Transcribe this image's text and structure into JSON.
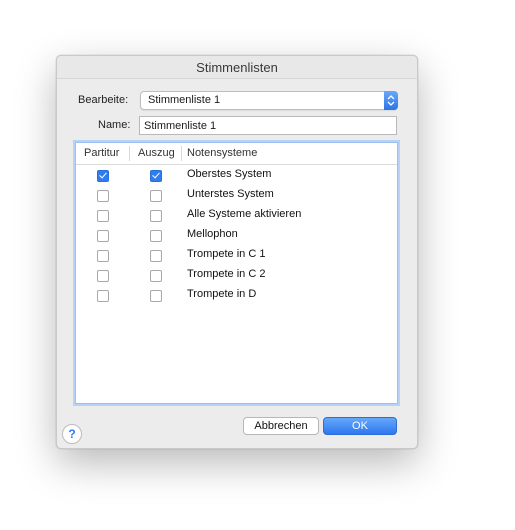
{
  "window": {
    "title": "Stimmenlisten"
  },
  "edit": {
    "label": "Bearbeite:",
    "selected": "Stimmenliste 1"
  },
  "name": {
    "label": "Name:",
    "value": "Stimmenliste 1"
  },
  "table": {
    "columns": [
      "Partitur",
      "Auszug",
      "Notensysteme"
    ],
    "rows": [
      {
        "name": "Oberstes System",
        "score": true,
        "part": true
      },
      {
        "name": "Unterstes System",
        "score": false,
        "part": false
      },
      {
        "name": "Alle Systeme aktivieren",
        "score": false,
        "part": false
      },
      {
        "name": "Mellophon",
        "score": false,
        "part": false
      },
      {
        "name": "Trompete in C 1",
        "score": false,
        "part": false
      },
      {
        "name": "Trompete in C 2",
        "score": false,
        "part": false
      },
      {
        "name": "Trompete in D",
        "score": false,
        "part": false
      }
    ]
  },
  "buttons": {
    "cancel": "Abbrechen",
    "ok": "OK",
    "help": "?"
  },
  "colors": {
    "accent": "#2f7df0",
    "window_bg": "#ececec"
  },
  "icons": {
    "popup": "up-down-arrows-icon",
    "help": "help-icon"
  }
}
